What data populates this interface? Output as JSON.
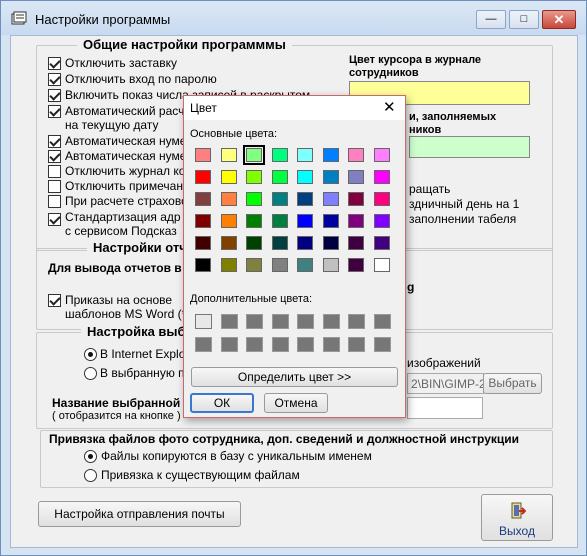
{
  "window": {
    "title": "Настройки программы",
    "minimize": "—",
    "maximize": "□",
    "close": "✕"
  },
  "general": {
    "title": "Общие настройки программмы",
    "options": [
      {
        "label": "Отключить заставку",
        "checked": true
      },
      {
        "label": "Отключить вход по паролю",
        "checked": true
      },
      {
        "label": "Включить показ числа записей в раскрытом",
        "checked": true
      },
      {
        "label": "Автоматический расчет",
        "checked": true
      },
      {
        "label": "на текущую дату",
        "checked": false
      },
      {
        "label": "Автоматическая нуме",
        "checked": true
      },
      {
        "label": "Автоматическая нуме",
        "checked": true
      },
      {
        "label": "Отключить журнал ко",
        "checked": false
      },
      {
        "label": "Отключить примечан",
        "checked": false
      },
      {
        "label": "При расчете страхово",
        "checked": false
      },
      {
        "label": "Стандартизация адр",
        "checked": true
      },
      {
        "label": "с сервисом Подсказ",
        "checked": false
      }
    ],
    "cursor_color_label": "Цвет курсора в журнале сотрудников",
    "cursor_color_line1": "Цвет курсора в журнале",
    "cursor_color_line2": "сотрудников",
    "cursor_color_value": "#ffff99",
    "filled_color_line1": "и, заполняемых",
    "filled_color_line2": "ников",
    "filled_color_value": "#ccffcc",
    "frag1": "ращать",
    "frag2": "здничный день на 1",
    "frag3": "заполнении табеля"
  },
  "reports": {
    "title": "Настройки отч",
    "label": "Для вывода отчетов в",
    "frag_g": "g",
    "orders_line1": "Приказы на основе",
    "orders_line2": "шаблонов MS Word (*",
    "orders_checked": true
  },
  "browser": {
    "title": "Настройка выб",
    "opt1": "В Internet Explo",
    "opt2": "В выбранную п",
    "selected": 0,
    "images_label": "изображений",
    "path_value": "2\\BIN\\GIMP-2",
    "choose_button": "Выбрать",
    "name_label": "Название выбранной п",
    "name_hint": "( отобразится на кнопке )"
  },
  "photo": {
    "title": "Привязка файлов фото сотрудника, доп. сведений и должностной инструкции",
    "opt1": "Файлы копируются в базу с уникальным именем",
    "opt2": "Привязка к существующим файлам",
    "selected": 0
  },
  "mail_button": "Настройка отправления почты",
  "exit_button": "Выход",
  "color_dialog": {
    "title": "Цвет",
    "basic_label": "Основные цвета:",
    "custom_label": "Дополнительные цвета:",
    "define_button": "Определить цвет >>",
    "ok_button": "ОК",
    "cancel_button": "Отмена",
    "selected_index": 2,
    "basic_colors": [
      "#ff8080",
      "#ffff80",
      "#80ff80",
      "#00ff80",
      "#80ffff",
      "#0080ff",
      "#ff80c0",
      "#ff80ff",
      "#ff0000",
      "#ffff00",
      "#80ff00",
      "#00ff40",
      "#00ffff",
      "#0080c0",
      "#8080c0",
      "#ff00ff",
      "#804040",
      "#ff8040",
      "#00ff00",
      "#008080",
      "#004080",
      "#8080ff",
      "#800040",
      "#ff0080",
      "#800000",
      "#ff8000",
      "#008000",
      "#008040",
      "#0000ff",
      "#0000a0",
      "#800080",
      "#8000ff",
      "#400000",
      "#804000",
      "#004000",
      "#004040",
      "#000080",
      "#000040",
      "#400040",
      "#400080",
      "#000000",
      "#808000",
      "#808040",
      "#808080",
      "#408080",
      "#c0c0c0",
      "#400040",
      "#ffffff"
    ]
  }
}
